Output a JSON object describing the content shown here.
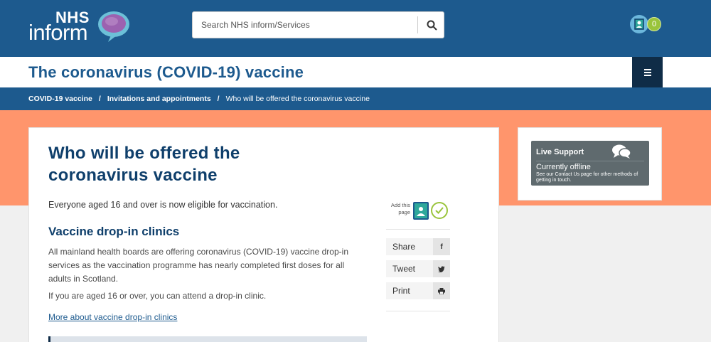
{
  "header": {
    "logo_top": "NHS",
    "logo_bottom": "inform",
    "search_placeholder": "Search NHS inform/Services",
    "search_icon": "search-icon",
    "saved_count": "0"
  },
  "title_bar": {
    "heading": "The coronavirus (COVID-19) vaccine",
    "menu_icon": "hamburger-icon"
  },
  "breadcrumb": {
    "items": [
      "COVID-19 vaccine",
      "Invitations and appointments",
      "Who will be offered the coronavirus vaccine"
    ],
    "separator": "/"
  },
  "article": {
    "title": "Who will be offered the coronavirus vaccine",
    "intro": "Everyone aged 16 and over is now eligible for vaccination.",
    "section_heading": "Vaccine drop-in clinics",
    "paragraph": "All mainland health boards are offering coronavirus (COVID-19) vaccine drop-in services as the vaccination programme has nearly completed first doses for all adults in Scotland.",
    "paragraph2": "If you are aged 16 or over, you can attend a drop-in clinic.",
    "link": "More about vaccine drop-in clinics"
  },
  "tools": {
    "add_label": "Add this page",
    "share": [
      {
        "label": "Share",
        "icon": "f"
      },
      {
        "label": "Tweet",
        "icon": "twitter-icon"
      },
      {
        "label": "Print",
        "icon": "print-icon"
      }
    ]
  },
  "support": {
    "title": "Live Support",
    "status": "Currently offline",
    "note": "See our Contact Us page for other methods of getting in touch."
  },
  "colors": {
    "brand_blue": "#1d5a8e",
    "dark_navy": "#0f2c47",
    "orange_band": "#ff956c",
    "green_accent": "#9ac43c"
  }
}
